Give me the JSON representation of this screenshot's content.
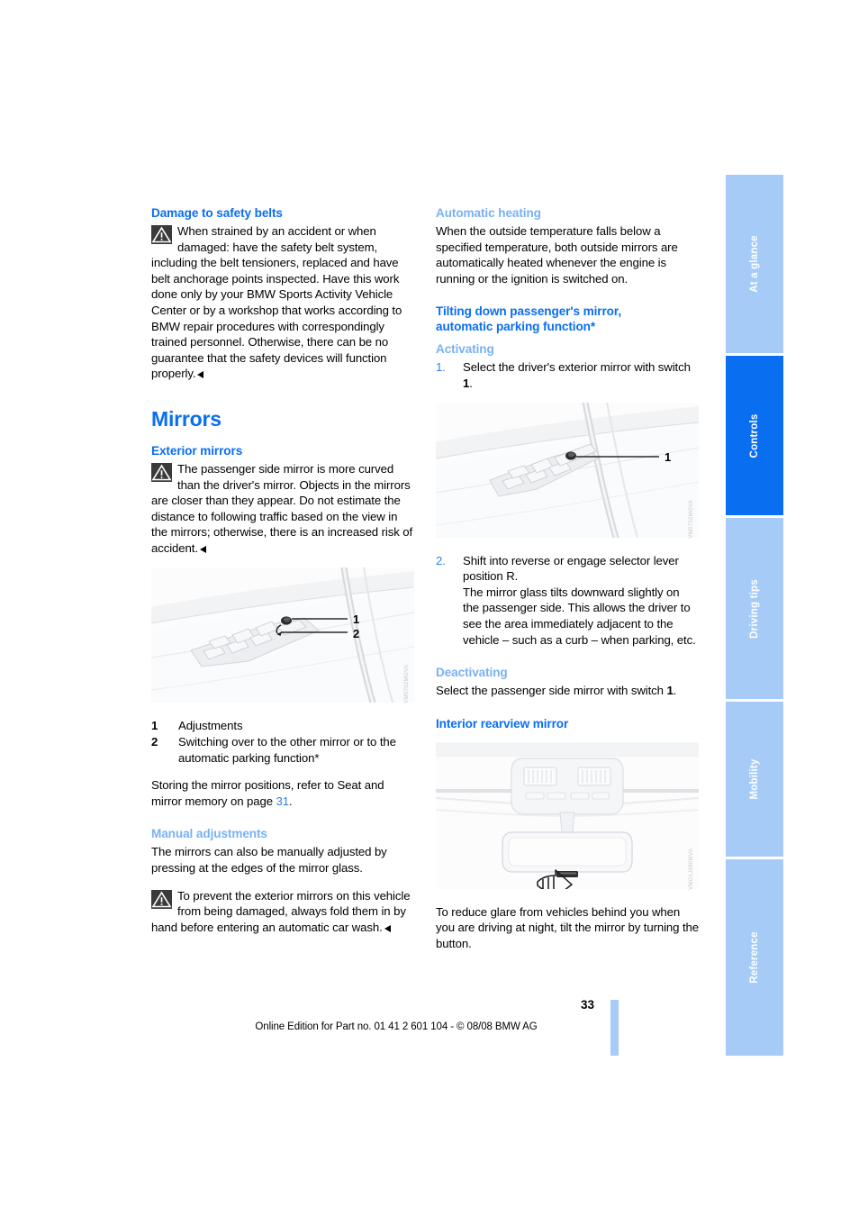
{
  "page": {
    "number": "33",
    "footer_text": "Online Edition for Part no. 01 41 2 601 104 - © 08/08 BMW AG"
  },
  "sidebar": {
    "tabs": [
      {
        "label": "At a glance",
        "active": false
      },
      {
        "label": "Controls",
        "active": true
      },
      {
        "label": "Driving tips",
        "active": false
      },
      {
        "label": "Mobility",
        "active": false
      },
      {
        "label": "Reference",
        "active": false
      }
    ]
  },
  "left_column": {
    "damage_heading": "Damage to safety belts",
    "damage_note": "When strained by an accident or when damaged: have the safety belt system, including the belt tensioners, replaced and have belt anchorage points inspected. Have this work done only by your BMW Sports Activity Vehicle Center or by a workshop that works according to BMW repair procedures with correspondingly trained personnel. Otherwise, there can be no guarantee that the safety devices will function properly.",
    "mirrors_title": "Mirrors",
    "exterior_heading": "Exterior mirrors",
    "exterior_note": "The passenger side mirror is more curved than the driver's mirror. Objects in the mirrors are closer than they appear. Do not estimate the distance to following traffic based on the view in the mirrors; otherwise, there is an increased risk of accident.",
    "figure_door_switch": {
      "name": "door-panel-mirror-switch-illustration",
      "callout_1": "1",
      "callout_2": "2",
      "code": "VM0702MOVA"
    },
    "key_items": [
      {
        "num": "1",
        "text": "Adjustments"
      },
      {
        "num": "2",
        "text": "Switching over to the other mirror or to the automatic parking function*"
      }
    ],
    "memory_text_before": "Storing the mirror positions, refer to Seat and mirror memory on page ",
    "memory_page_ref": "31",
    "memory_text_after": ".",
    "manual_heading": "Manual adjustments",
    "manual_text": "The mirrors can also be manually adjusted by pressing at the edges of the mirror glass.",
    "manual_note": "To prevent the exterior mirrors on this vehicle from being damaged, always fold them in by hand before entering an automatic car wash."
  },
  "right_column": {
    "heating_heading": "Automatic heating",
    "heating_text": "When the outside temperature falls below a specified temperature, both outside mirrors are automatically heated whenever the engine is running or the ignition is switched on.",
    "tilting_heading_line1": "Tilting down passenger's mirror,",
    "tilting_heading_line2": "automatic parking function*",
    "activating_heading": "Activating",
    "step_1_num": "1.",
    "step_1_text_a": "Select the driver's exterior mirror with switch ",
    "step_1_bold": "1",
    "step_1_text_b": ".",
    "figure_door_switch_2": {
      "name": "door-panel-driver-mirror-switch-illustration",
      "callout_1": "1",
      "code": "VM0702MOVA"
    },
    "step_2_num": "2.",
    "step_2_text": "Shift into reverse or engage selector lever position R.",
    "step_2_text_extra": "The mirror glass tilts downward slightly on the passenger side. This allows the driver to see the area immediately adjacent to the vehicle – such as a curb – when parking, etc.",
    "deactivating_heading": "Deactivating",
    "deactivating_text_a": "Select the passenger side mirror with switch ",
    "deactivating_bold": "1",
    "deactivating_text_b": ".",
    "interior_heading": "Interior rearview mirror",
    "figure_interior_mirror": {
      "name": "interior-rearview-mirror-illustration",
      "code": "VMO1J080MVA"
    },
    "interior_text": "To reduce glare from vehicles behind you when you are driving at night, tilt the mirror by turning the button."
  },
  "colors": {
    "heading_dark_blue": "#0a6ef0",
    "heading_light_blue": "#79b1f2",
    "tab_inactive": "#a7cbf7",
    "tab_active": "#0a6ef0",
    "link_blue": "#2e7df0"
  }
}
